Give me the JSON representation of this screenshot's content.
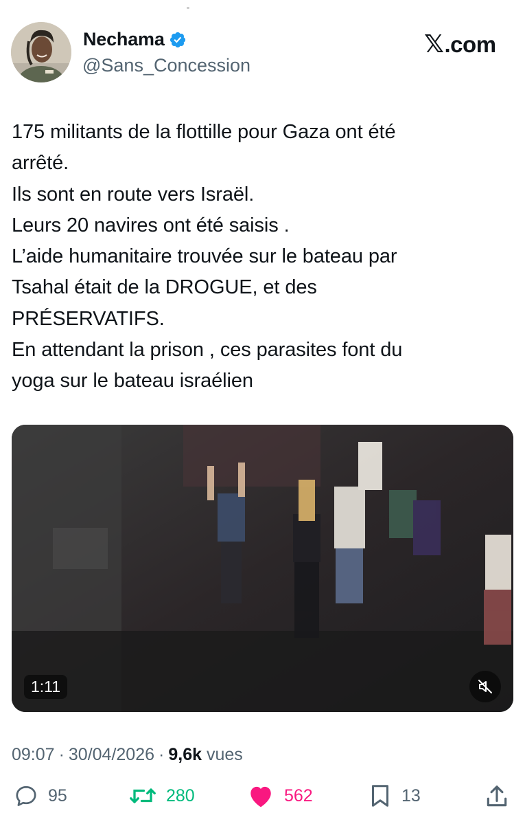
{
  "author": {
    "display_name": "Nechama",
    "handle": "@Sans_Concession",
    "verified": true
  },
  "platform": {
    "logo_text": ".com",
    "logo_mark": "𝕏"
  },
  "tweet": {
    "text": "175 militants de la flottille pour Gaza ont été\narrêté.\nIls sont en route vers Israël.\nLeurs 20 navires ont été saisis .\nL’aide humanitaire trouvée sur le bateau par\nTsahal était de la DROGUE, et des\nPRÉSERVATIFS.\nEn attendant la prison , ces parasites font du\nyoga sur le bateau israélien"
  },
  "video": {
    "duration": "1:11",
    "muted": true
  },
  "meta": {
    "time": "09:07",
    "sep1": "·",
    "date": "30/04/2026",
    "sep2": "·",
    "views_count": "9,6k",
    "views_label": "vues"
  },
  "actions": {
    "replies": "95",
    "retweets": "280",
    "likes": "562",
    "bookmarks": "13"
  },
  "colors": {
    "verified_blue": "#1d9bf0",
    "retweet_green": "#00ba7c",
    "like_pink": "#f91880",
    "muted_gray": "#536471"
  }
}
